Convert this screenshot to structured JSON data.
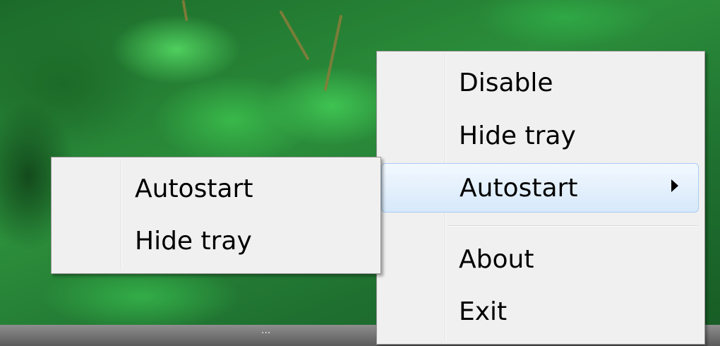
{
  "context_menu": {
    "items": [
      {
        "label": "Disable"
      },
      {
        "label": "Hide tray"
      },
      {
        "label": "Autostart",
        "has_submenu": true,
        "highlighted": true
      },
      {
        "label": "About"
      },
      {
        "label": "Exit"
      }
    ]
  },
  "submenu": {
    "items": [
      {
        "label": "Autostart"
      },
      {
        "label": "Hide tray"
      }
    ]
  },
  "taskbar": {
    "overflow_label": "..."
  },
  "colors": {
    "menu_bg": "#f0f0f0",
    "highlight_border": "#a9cdf0",
    "highlight_fill": "#d6e8fb"
  }
}
